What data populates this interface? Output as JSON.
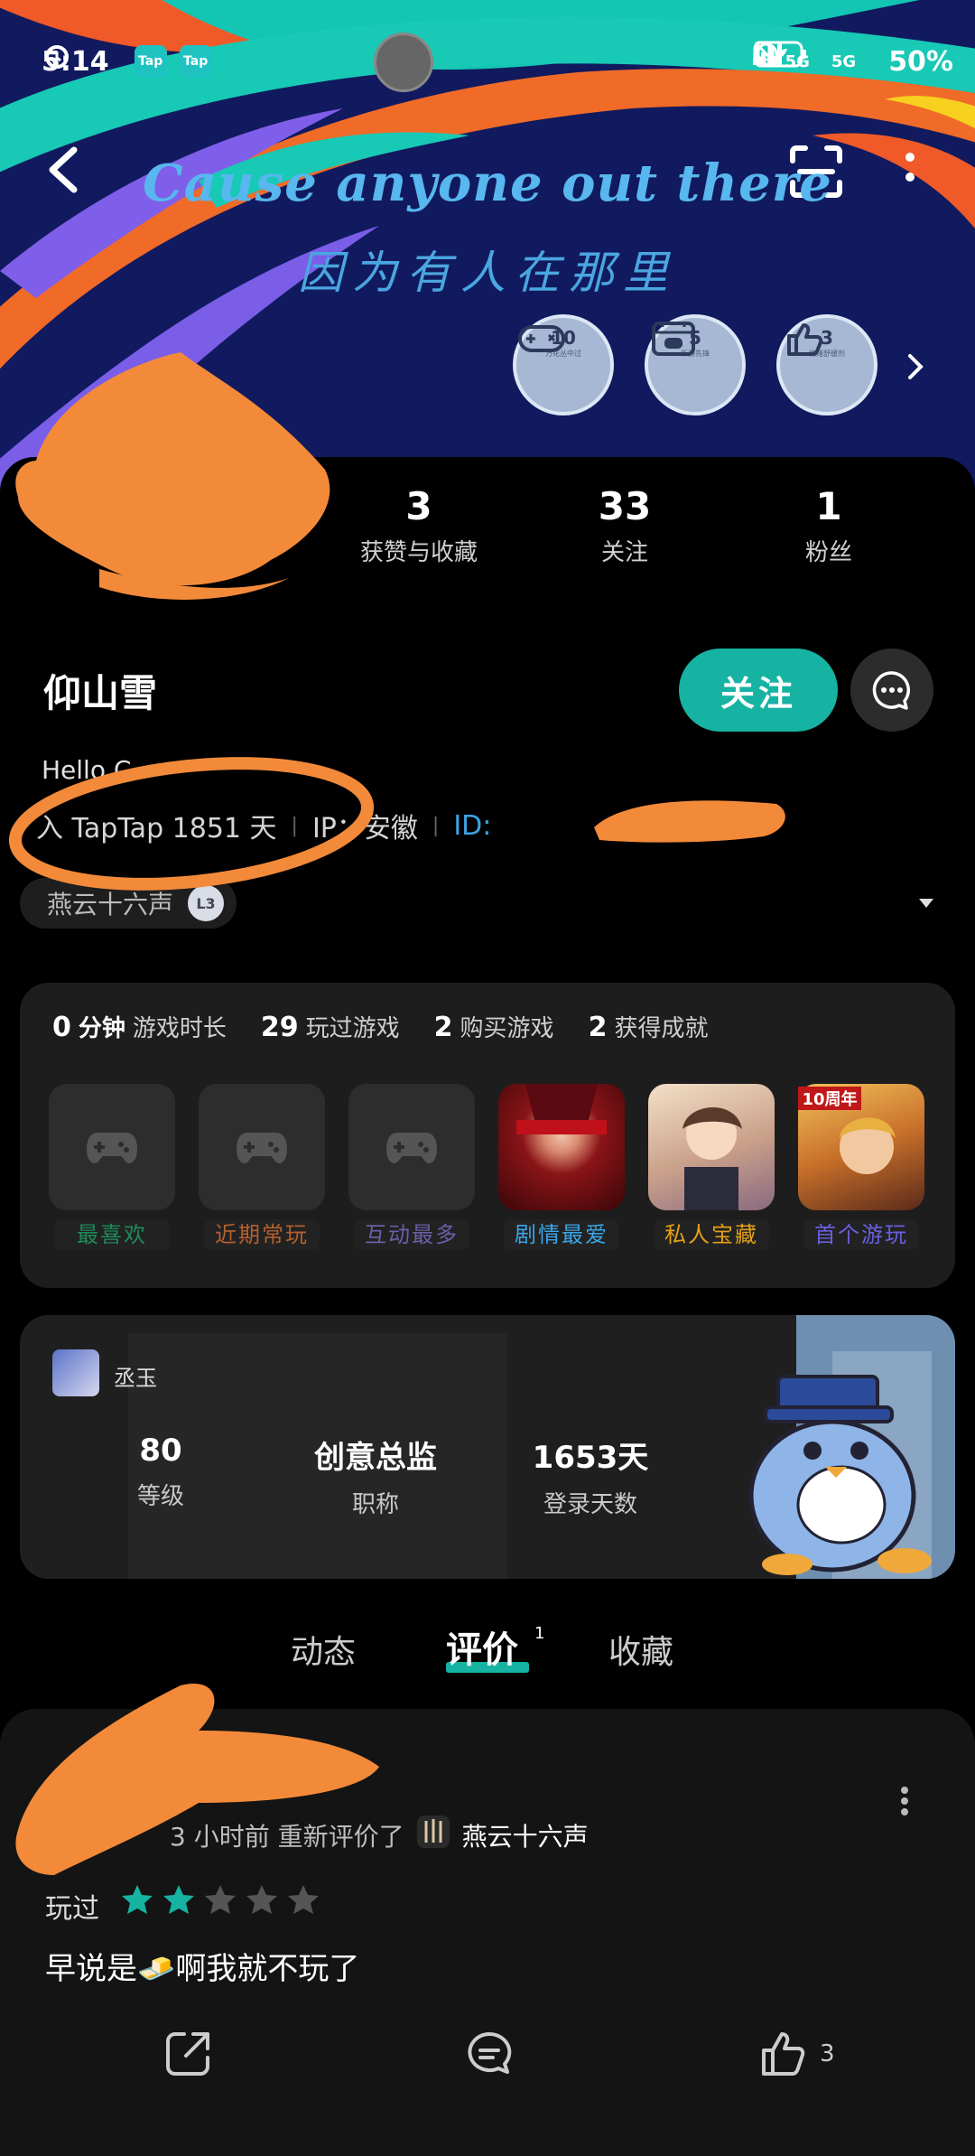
{
  "status_bar": {
    "time": "5:14",
    "app_badge_1": "Tap",
    "app_badge_2": "Tap",
    "network_1": "5G",
    "network_2": "5G",
    "battery": "50%"
  },
  "banner": {
    "line1": "Cause anyone out there",
    "line2": "因为有人在那里",
    "medals": [
      {
        "count": "10",
        "caption": "万花丛中过"
      },
      {
        "count": "5",
        "caption": "新游先锋"
      },
      {
        "count": "3",
        "caption": "情绪舒缓剂"
      }
    ]
  },
  "stats": [
    {
      "value": "3",
      "label": "获赞与收藏"
    },
    {
      "value": "33",
      "label": "关注"
    },
    {
      "value": "1",
      "label": "粉丝"
    }
  ],
  "profile": {
    "name": "仰山雪",
    "follow_label": "关注",
    "bio": "Hello C",
    "joined": "入 TapTap 1851 天",
    "ip": "IP：安徽",
    "id_label": "ID:",
    "fav_game": "燕云十六声",
    "fav_game_level": "L3"
  },
  "games": {
    "stats": [
      {
        "value": "0",
        "unit": "分钟",
        "label": "游戏时长"
      },
      {
        "value": "29",
        "unit": "",
        "label": "玩过游戏"
      },
      {
        "value": "2",
        "unit": "",
        "label": "购买游戏"
      },
      {
        "value": "2",
        "unit": "",
        "label": "获得成就"
      }
    ],
    "slots": [
      {
        "tag": "最喜欢",
        "color": "#1e8a5c"
      },
      {
        "tag": "近期常玩",
        "color": "#b5602e"
      },
      {
        "tag": "互动最多",
        "color": "#6a5fa8"
      },
      {
        "tag": "剧情最爱",
        "color": "#3aa4e6"
      },
      {
        "tag": "私人宝藏",
        "color": "#e3a018"
      },
      {
        "tag": "首个游玩",
        "color": "#6a5fe0"
      }
    ],
    "slot6_badge": "10周年"
  },
  "level_card": {
    "name": "丞玉",
    "level": "80",
    "level_label": "等级",
    "title": "创意总监",
    "title_label": "职称",
    "days": "1653天",
    "days_label": "登录天数"
  },
  "tabs": {
    "posts": "动态",
    "reviews": "评价",
    "reviews_count": "1",
    "favorites": "收藏"
  },
  "review": {
    "meta": "3 小时前  重新评价了",
    "game": "燕云十六声",
    "played_label": "玩过",
    "rating": 2,
    "rating_max": 5,
    "text": "早说是🧈啊我就不玩了",
    "likes": "3"
  },
  "colors": {
    "accent": "#16b3a3",
    "id_blue": "#3aa4e6",
    "scribble": "#f28a3a"
  }
}
